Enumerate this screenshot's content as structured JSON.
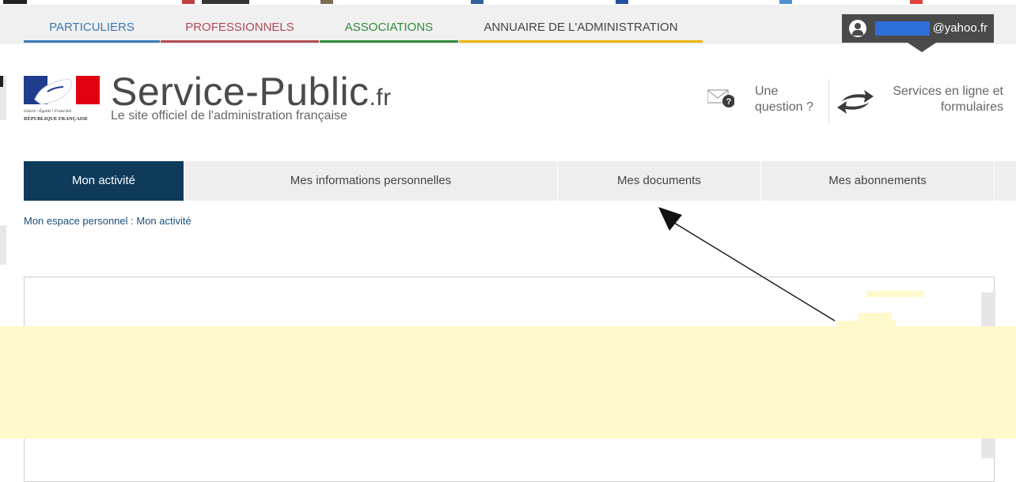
{
  "audience_tabs": [
    {
      "label": "PARTICULIERS",
      "color": "#3a78b5"
    },
    {
      "label": "PROFESSIONNELS",
      "color": "#b04a56"
    },
    {
      "label": "ASSOCIATIONS",
      "color": "#2f8a3c"
    },
    {
      "label": "ANNUAIRE DE L'ADMINISTRATION",
      "color": "#f0b400"
    }
  ],
  "user": {
    "email_suffix": "@yahoo.fr"
  },
  "header": {
    "site_name": "Service-Public",
    "site_tld": ".fr",
    "tagline": "Le site officiel de l'administration française",
    "logo_text_1": "Liberté • Égalité • Fraternité",
    "logo_text_2": "RÉPUBLIQUE FRANÇAISE",
    "question_label": "Une question ?",
    "services_label": "Services en ligne et formulaires"
  },
  "account_nav": [
    {
      "label": "Mon activité",
      "active": true
    },
    {
      "label": "Mes informations personnelles",
      "active": false
    },
    {
      "label": "Mes documents",
      "active": false
    },
    {
      "label": "Mes abonnements",
      "active": false
    }
  ],
  "breadcrumb": "Mon espace personnel : Mon activité",
  "colors": {
    "brand_dark": "#0e3a5c",
    "highlight": "#fff9cc"
  }
}
